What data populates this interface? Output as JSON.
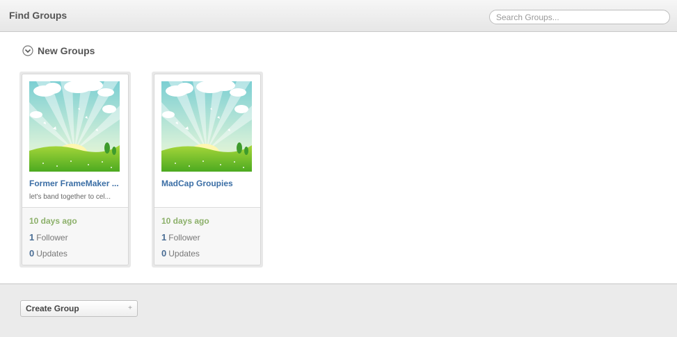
{
  "header": {
    "title": "Find Groups",
    "search_placeholder": "Search Groups..."
  },
  "section": {
    "title": "New Groups",
    "icon": "chevron-down-circle-icon"
  },
  "groups": [
    {
      "name": "Former FrameMaker ...",
      "description": "let's band together to cel...",
      "date": "10 days ago",
      "followers_count": "1",
      "followers_label": "Follower",
      "updates_count": "0",
      "updates_label": "Updates"
    },
    {
      "name": "MadCap Groupies",
      "description": "",
      "date": "10 days ago",
      "followers_count": "1",
      "followers_label": "Follower",
      "updates_count": "0",
      "updates_label": "Updates"
    }
  ],
  "footer": {
    "create_label": "Create Group",
    "create_icon": "plus-icon",
    "create_icon_glyph": "+"
  },
  "colors": {
    "link": "#3b6ea5",
    "date": "#8cb06a",
    "count": "#4a6d94"
  }
}
